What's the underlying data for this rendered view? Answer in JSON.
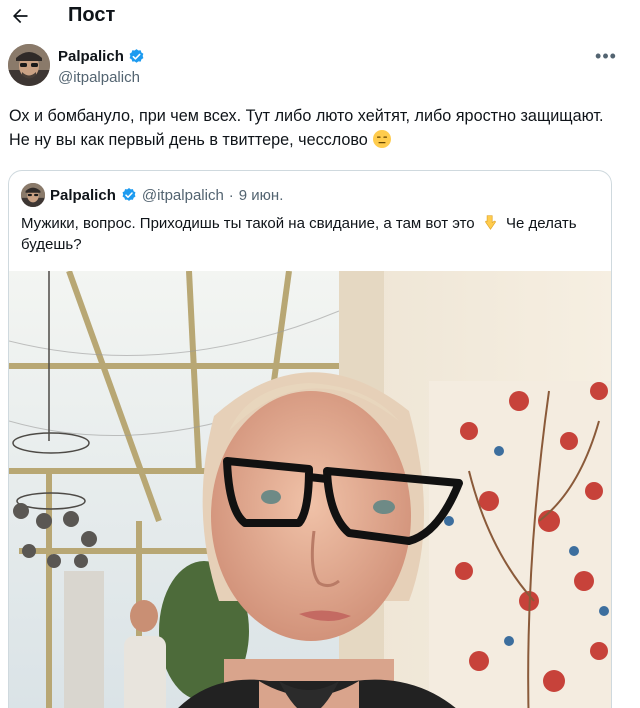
{
  "header": {
    "title": "Пост",
    "back_icon": "arrow-left-icon"
  },
  "post": {
    "author": {
      "name": "Palpalich",
      "handle": "@itpalpalich",
      "verified": true
    },
    "text": "Ох и бомбануло, при чем всех. Тут либо люто хейтят, либо яростно защищают. Не ну вы как первый день в твиттере, чесслово",
    "emoji": "expressionless-face",
    "more_icon": "more-options-icon"
  },
  "quote": {
    "author": {
      "name": "Palpalich",
      "handle": "@itpalpalich",
      "verified": true
    },
    "separator": "·",
    "date": "9 июн.",
    "text": "Мужики, вопрос. Приходишь ты такой на свидание, а там вот это",
    "text_emoji": "backhand-index-pointing-down",
    "text_after": "Че делать будешь?",
    "image": "selfie of a woman with glasses in a glass-roof cafe with an ornate floral wall"
  },
  "colors": {
    "text": "#0f1419",
    "secondary": "#536471",
    "verified": "#1d9bf0",
    "border": "#cfd9de"
  }
}
